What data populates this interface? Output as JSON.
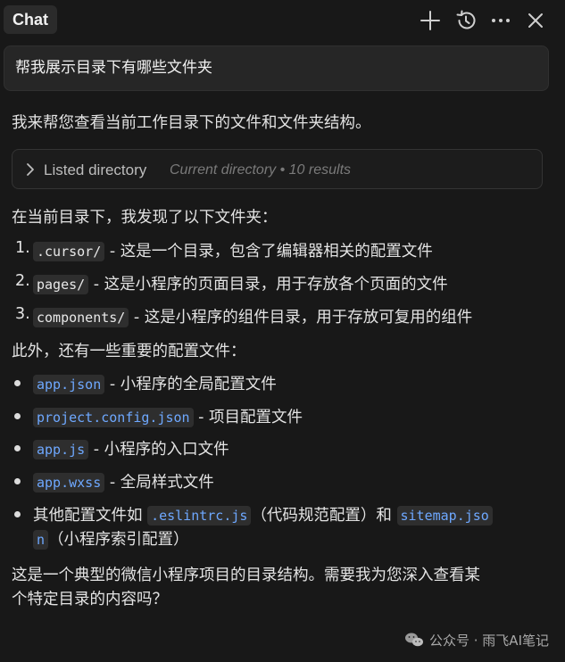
{
  "header": {
    "title": "Chat",
    "icons": [
      "plus-icon",
      "history-icon",
      "more-icon",
      "close-icon"
    ]
  },
  "user_message": "帮我展示目录下有哪些文件夹",
  "reply": {
    "intro": "我来帮您查看当前工作目录下的文件和文件夹结构。",
    "tool": {
      "label": "Listed directory",
      "meta": "Current directory • 10 results"
    },
    "folders_intro": "在当前目录下，我发现了以下文件夹：",
    "folders": [
      {
        "num": "1.",
        "code": ".cursor/",
        "desc": " - 这是一个目录，包含了编辑器相关的配置文件"
      },
      {
        "num": "2.",
        "code": "pages/",
        "desc": " - 这是小程序的页面目录，用于存放各个页面的文件"
      },
      {
        "num": "3.",
        "code": "components/",
        "desc": " - 这是小程序的组件目录，用于存放可复用的组件"
      }
    ],
    "files_intro": "此外，还有一些重要的配置文件：",
    "files": [
      {
        "code": "app.json",
        "desc": " - 小程序的全局配置文件"
      },
      {
        "code": "project.config.json",
        "desc": " - 项目配置文件"
      },
      {
        "code": "app.js",
        "desc": " - 小程序的入口文件"
      },
      {
        "code": "app.wxss",
        "desc": " - 全局样式文件"
      }
    ],
    "other": {
      "prefix": "其他配置文件如 ",
      "code1": ".eslintrc.js",
      "mid": "（代码规范配置）和 ",
      "code2a": "sitemap.jso",
      "code2b": "n",
      "suffix": "（小程序索引配置）"
    },
    "closing_1": "这是一个典型的微信小程序项目的目录结构。需要我为您深入查看某",
    "closing_2": "个特定目录的内容吗？"
  },
  "watermark": "公众号 · 雨飞AI笔记"
}
